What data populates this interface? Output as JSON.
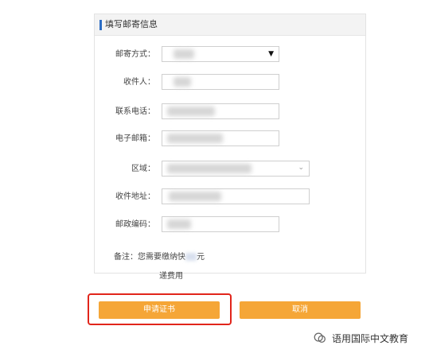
{
  "form": {
    "title": "填写邮寄信息",
    "fields": [
      {
        "label": "邮寄方式：",
        "type": "select"
      },
      {
        "label": "收件人：",
        "type": "text"
      },
      {
        "label": "联系电话：",
        "type": "text"
      },
      {
        "label": "电子邮箱：",
        "type": "text"
      },
      {
        "label": "区域：",
        "type": "select-chevron"
      },
      {
        "label": "收件地址：",
        "type": "text"
      },
      {
        "label": "邮政编码：",
        "type": "text"
      }
    ],
    "note_prefix": "备注：您需要缴纳快",
    "note_suffix": "元",
    "note_line2": "递费用"
  },
  "buttons": {
    "apply": "申请证书",
    "cancel": "取消"
  },
  "watermark": {
    "text": "语用国际中文教育"
  },
  "colors": {
    "accent": "#f5a637",
    "highlight": "#e1251b",
    "header_bar": "#2b6cc4"
  },
  "icons": {
    "select_caret": "▼",
    "chevron": "⌄"
  }
}
